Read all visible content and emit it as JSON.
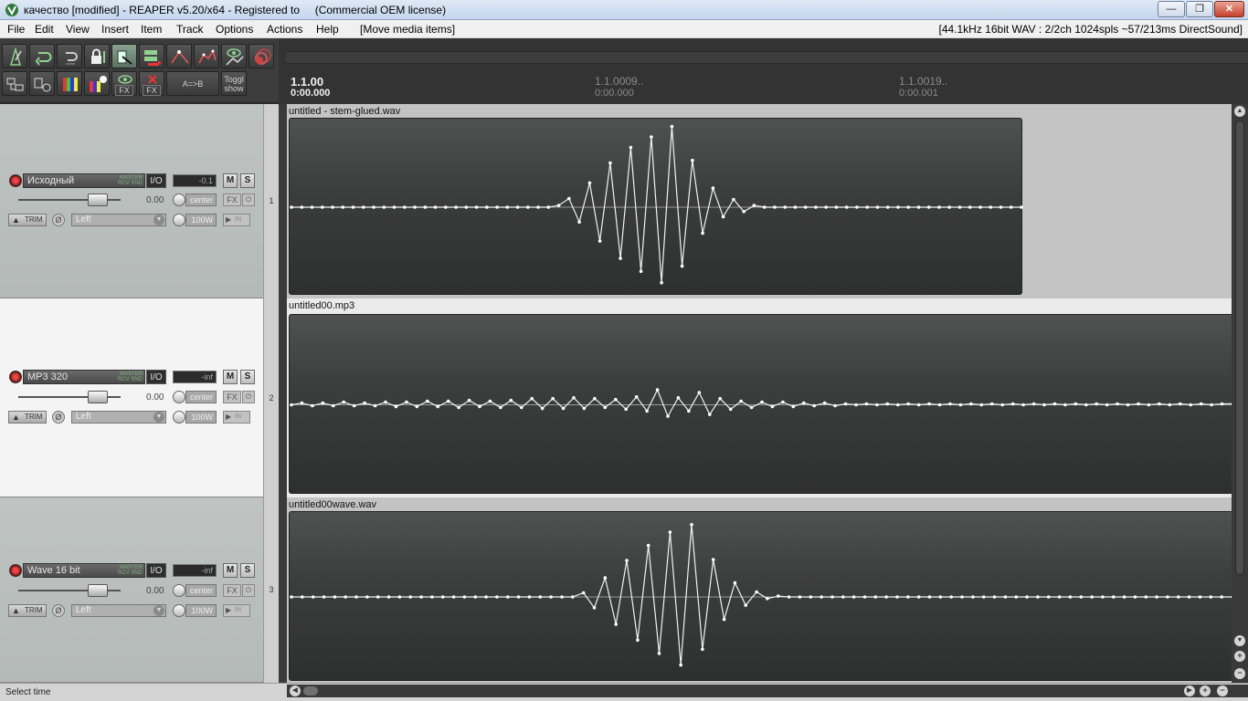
{
  "window": {
    "title": "качество [modified] - REAPER v5.20/x64 - Registered to     (Commercial OEM license)",
    "buttons": {
      "minimize": "—",
      "maximize": "❐",
      "close": "✕"
    }
  },
  "menu": {
    "items": [
      "File",
      "Edit",
      "View",
      "Insert",
      "Item",
      "Track",
      "Options",
      "Actions",
      "Help"
    ],
    "undo_hint": "[Move media items]",
    "audio_status": "[44.1kHz 16bit WAV : 2/2ch 1024spls ~57/213ms DirectSound]"
  },
  "toolbar": {
    "ab_label": "A=>B",
    "toggle_show_label_1": "Toggl",
    "toggle_show_label_2": "show",
    "fx_label": "FX"
  },
  "ruler": {
    "markers": [
      {
        "beat": "1.1.00",
        "time": "0:00.000"
      },
      {
        "beat": "1.1.0009..",
        "time": "0:00.000"
      },
      {
        "beat": "1.1.0019..",
        "time": "0:00.001"
      }
    ]
  },
  "tracks": [
    {
      "number": "1",
      "name": "Исходный",
      "master_send_1": "MASTER",
      "master_send_2": "RCV SND",
      "io": "I/O",
      "peak": "-0.1",
      "mute": "M",
      "solo": "S",
      "volume": "0.00",
      "pan": "center",
      "fx": "FX",
      "trim": "TRIM",
      "phase": "Ø",
      "pan_mode": "Left",
      "width": "100W",
      "input_label": "IN",
      "arrow": "▲"
    },
    {
      "number": "2",
      "name": "MP3 320",
      "master_send_1": "MASTER",
      "master_send_2": "RCV SND",
      "io": "I/O",
      "peak": "-inf",
      "mute": "M",
      "solo": "S",
      "volume": "0.00",
      "pan": "center",
      "fx": "FX",
      "trim": "TRIM",
      "phase": "Ø",
      "pan_mode": "Left",
      "width": "100W",
      "input_label": "IN",
      "arrow": "▲"
    },
    {
      "number": "3",
      "name": "Wave 16 bit",
      "master_send_1": "MASTER",
      "master_send_2": "RCV SND",
      "io": "I/O",
      "peak": "-inf",
      "mute": "M",
      "solo": "S",
      "volume": "0.00",
      "pan": "center",
      "fx": "FX",
      "trim": "TRIM",
      "phase": "Ø",
      "pan_mode": "Left",
      "width": "100W",
      "input_label": "IN",
      "arrow": "▲"
    }
  ],
  "items": [
    {
      "name": "untitled - stem-glued.wav"
    },
    {
      "name": "untitled00.mp3"
    },
    {
      "name": "untitled00wave.wav"
    }
  ],
  "waveforms": {
    "wav_glued": [
      0,
      0,
      0,
      0,
      0,
      0,
      0,
      0,
      0,
      0,
      0,
      0,
      0,
      0,
      0,
      0,
      0,
      0,
      0,
      0,
      0,
      0,
      0,
      0,
      0,
      0,
      0.02,
      0.1,
      -0.17,
      0.28,
      -0.39,
      0.51,
      -0.59,
      0.69,
      -0.74,
      0.81,
      -0.87,
      0.93,
      -0.68,
      0.54,
      -0.3,
      0.22,
      -0.11,
      0.09,
      -0.05,
      0.02,
      0,
      0,
      0,
      0,
      0,
      0,
      0,
      0,
      0,
      0,
      0,
      0,
      0,
      0,
      0,
      0,
      0,
      0,
      0,
      0,
      0,
      0,
      0,
      0,
      0,
      0
    ],
    "mp3": [
      0,
      0.02,
      -0.01,
      0.02,
      -0.01,
      0.03,
      -0.01,
      0.02,
      -0.01,
      0.03,
      -0.02,
      0.03,
      -0.02,
      0.04,
      -0.02,
      0.04,
      -0.03,
      0.05,
      -0.02,
      0.04,
      -0.03,
      0.05,
      -0.03,
      0.07,
      -0.04,
      0.07,
      -0.04,
      0.08,
      -0.04,
      0.07,
      -0.03,
      0.06,
      -0.05,
      0.09,
      -0.07,
      0.17,
      -0.13,
      0.08,
      -0.07,
      0.14,
      -0.11,
      0.07,
      -0.05,
      0.04,
      -0.03,
      0.03,
      -0.02,
      0.03,
      -0.02,
      0.02,
      -0.01,
      0.02,
      -0.01,
      0.01,
      0,
      0.01,
      0,
      0.01,
      0,
      0.01,
      0,
      0.01,
      0,
      0.01,
      0,
      0.01,
      0,
      0.01,
      0,
      0.01,
      0,
      0.01,
      0,
      0.01,
      0,
      0.01,
      0,
      0.01,
      0,
      0.01,
      0,
      0.01,
      0,
      0.01,
      0,
      0.01,
      0,
      0.01,
      0,
      0.01,
      0.01
    ],
    "wav16": [
      0,
      0,
      0,
      0,
      0,
      0,
      0,
      0,
      0,
      0,
      0,
      0,
      0,
      0,
      0,
      0,
      0,
      0,
      0,
      0,
      0,
      0,
      0,
      0,
      0,
      0,
      0,
      0.05,
      -0.13,
      0.23,
      -0.33,
      0.44,
      -0.52,
      0.62,
      -0.68,
      0.78,
      -0.82,
      0.87,
      -0.63,
      0.45,
      -0.27,
      0.17,
      -0.1,
      0.06,
      -0.02,
      0.01,
      0,
      0,
      0,
      0,
      0,
      0,
      0,
      0,
      0,
      0,
      0,
      0,
      0,
      0,
      0,
      0,
      0,
      0,
      0,
      0,
      0,
      0,
      0,
      0,
      0,
      0,
      0,
      0,
      0,
      0,
      0,
      0,
      0,
      0,
      0,
      0,
      0,
      0,
      0,
      0,
      0,
      0
    ]
  },
  "scroll": {
    "up": "▲",
    "down": "▼",
    "zoom_in": "+",
    "zoom_out": "−",
    "left": "◀",
    "right": "▶"
  },
  "statusbar": {
    "text": "Select time"
  }
}
